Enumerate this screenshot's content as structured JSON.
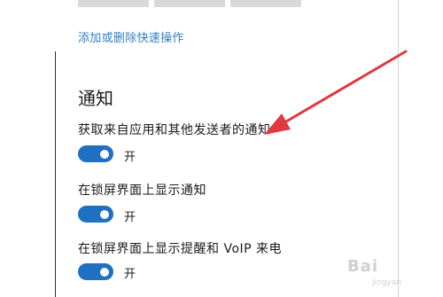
{
  "quick_actions": {
    "link_label": "添加或删除快速操作"
  },
  "notifications": {
    "title": "通知",
    "settings": [
      {
        "label": "获取来自应用和其他发送者的通知",
        "state_label": "开",
        "on": true
      },
      {
        "label": "在锁屏界面上显示通知",
        "state_label": "开",
        "on": true
      },
      {
        "label": "在锁屏界面上显示提醒和 VoIP 来电",
        "state_label": "开",
        "on": true
      }
    ]
  },
  "colors": {
    "accent": "#1f6fc2",
    "link": "#2f7fc4",
    "annotation_arrow": "#e2383f"
  },
  "watermark": {
    "brand": "Bai",
    "sub": "jingyan"
  }
}
